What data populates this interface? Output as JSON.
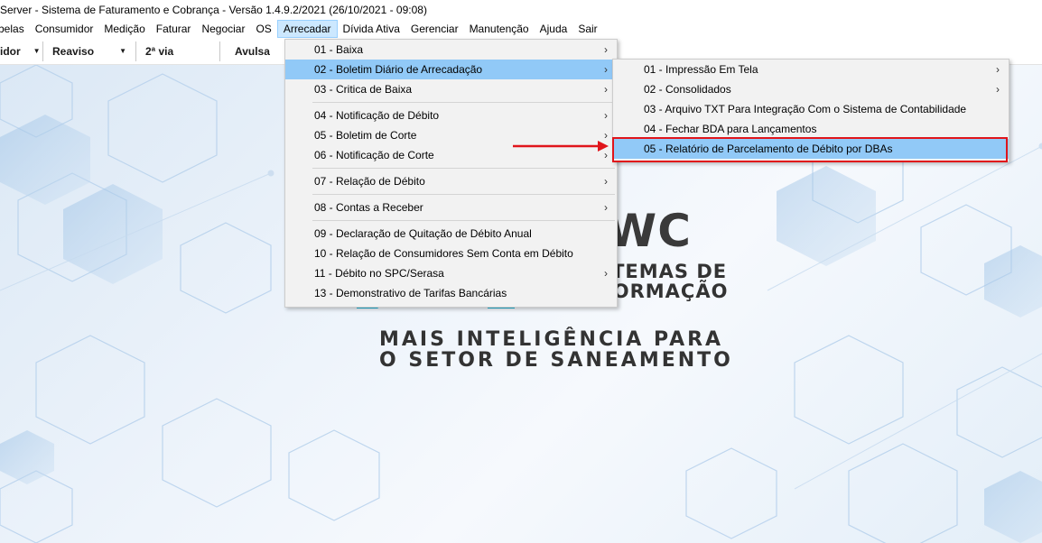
{
  "window": {
    "title": "Server - Sistema de Faturamento e Cobrança - Versão 1.4.9.2/2021 (26/10/2021 - 09:08)"
  },
  "menubar": {
    "items": [
      {
        "label": "belas"
      },
      {
        "label": "Consumidor"
      },
      {
        "label": "Medição"
      },
      {
        "label": "Faturar"
      },
      {
        "label": "Negociar"
      },
      {
        "label": "OS"
      },
      {
        "label": "Arrecadar"
      },
      {
        "label": "Dívida Ativa"
      },
      {
        "label": "Gerenciar"
      },
      {
        "label": "Manutenção"
      },
      {
        "label": "Ajuda"
      },
      {
        "label": "Sair"
      }
    ],
    "active": "Arrecadar"
  },
  "toolbar": {
    "items": [
      {
        "label": "idor",
        "has_dropdown": true
      },
      {
        "label": "Reaviso",
        "has_dropdown": true
      },
      {
        "label": "2ª via",
        "has_dropdown": false
      },
      {
        "label": "Avulsa",
        "has_dropdown": false
      }
    ]
  },
  "arrecadar_menu": {
    "items": [
      {
        "label": "01 - Baixa",
        "submenu": true
      },
      {
        "label": "02 - Boletim Diário de Arrecadação",
        "submenu": true,
        "highlighted": true
      },
      {
        "label": "03 - Critica de Baixa",
        "submenu": true
      },
      {
        "label": "04 - Notificação de Débito",
        "submenu": true
      },
      {
        "label": "05 - Boletim de Corte",
        "submenu": true
      },
      {
        "label": "06 - Notificação de Corte",
        "submenu": true
      },
      {
        "label": "07 - Relação de Débito",
        "submenu": true
      },
      {
        "label": "08 - Contas a Receber",
        "submenu": true
      },
      {
        "label": "09 - Declaração de Quitação de Débito Anual",
        "submenu": false
      },
      {
        "label": "10 - Relação de Consumidores Sem Conta em Débito",
        "submenu": false
      },
      {
        "label": "11 - Débito no SPC/Serasa",
        "submenu": true
      },
      {
        "label": "13 - Demonstrativo de Tarifas Bancárias",
        "submenu": false
      }
    ]
  },
  "boletim_submenu": {
    "items": [
      {
        "label": "01 - Impressão Em Tela",
        "submenu": true
      },
      {
        "label": "02 - Consolidados",
        "submenu": true
      },
      {
        "label": "03 - Arquivo TXT Para Integração Com o Sistema de Contabilidade",
        "submenu": false
      },
      {
        "label": "04 - Fechar BDA para Lançamentos",
        "submenu": false
      },
      {
        "label": "05 - Relatório de Parcelamento de Débito por DBAs",
        "submenu": false,
        "highlighted": true
      }
    ]
  },
  "logo": {
    "brand": "GWC",
    "sub1": "SISTEMAS DE",
    "sub2": "INFORMAÇÃO",
    "tagline1": "MAIS INTELIGÊNCIA PARA",
    "tagline2": "O SETOR DE SANEAMENTO",
    "accent_color": "#1fb7d9"
  },
  "annotation": {
    "highlight_color": "#e0151b"
  }
}
